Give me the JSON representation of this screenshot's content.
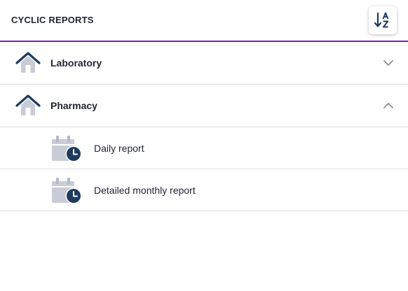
{
  "header": {
    "title": "CYCLIC REPORTS",
    "sort_button_icon": "sort-alpha-down-icon"
  },
  "groups": [
    {
      "label": "Laboratory",
      "icon": "home-icon",
      "expanded": false,
      "toggle_icon": "chevron-down-icon",
      "items": []
    },
    {
      "label": "Pharmacy",
      "icon": "home-icon",
      "expanded": true,
      "toggle_icon": "chevron-up-icon",
      "items": [
        {
          "label": "Daily report",
          "icon": "calendar-clock-icon"
        },
        {
          "label": "Detailed monthly report",
          "icon": "calendar-clock-icon"
        }
      ]
    }
  ],
  "colors": {
    "accent_line": "#7a1fa2",
    "icon_dark": "#1e3a5f",
    "icon_light": "#c9ccd6",
    "divider": "#dcdce0"
  }
}
